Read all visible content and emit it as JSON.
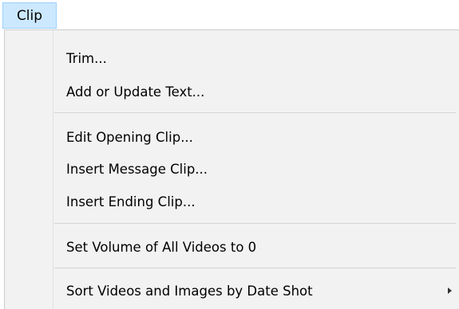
{
  "menubar": {
    "clip_label": "Clip"
  },
  "menu": {
    "items": [
      {
        "label": "Trim..."
      },
      {
        "label": "Add or Update Text..."
      },
      {
        "label": "Edit Opening Clip..."
      },
      {
        "label": "Insert Message Clip..."
      },
      {
        "label": "Insert Ending Clip..."
      },
      {
        "label": "Set Volume of All Videos to 0"
      },
      {
        "label": "Sort Videos and Images by Date Shot",
        "submenu_icon": "chevron-right-icon"
      }
    ]
  },
  "colors": {
    "menubar_highlight": "#cce8ff",
    "menubar_highlight_border": "#99d1ff",
    "menu_background": "#f2f2f2",
    "separator": "#d4d4d4"
  }
}
